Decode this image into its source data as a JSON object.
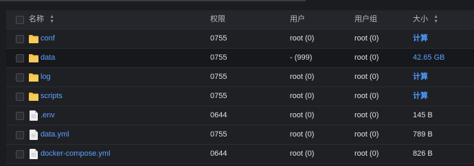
{
  "header": {
    "name_label": "名称",
    "perm_label": "权限",
    "user_label": "用户",
    "group_label": "用户组",
    "size_label": "大小"
  },
  "rows": [
    {
      "name": "conf",
      "type": "folder",
      "perm": "0755",
      "user": "root (0)",
      "group": "root (0)",
      "size": "计算",
      "size_kind": "action"
    },
    {
      "name": "data",
      "type": "folder",
      "perm": "0755",
      "user": "- (999)",
      "group": "root (0)",
      "size": "42.65 GB",
      "size_kind": "link"
    },
    {
      "name": "log",
      "type": "folder",
      "perm": "0755",
      "user": "root (0)",
      "group": "root (0)",
      "size": "计算",
      "size_kind": "action"
    },
    {
      "name": "scripts",
      "type": "folder",
      "perm": "0755",
      "user": "root (0)",
      "group": "root (0)",
      "size": "计算",
      "size_kind": "action"
    },
    {
      "name": ".env",
      "type": "file",
      "perm": "0644",
      "user": "root (0)",
      "group": "root (0)",
      "size": "145 B",
      "size_kind": "text"
    },
    {
      "name": "data.yml",
      "type": "file",
      "perm": "0755",
      "user": "root (0)",
      "group": "root (0)",
      "size": "789 B",
      "size_kind": "text"
    },
    {
      "name": "docker-compose.yml",
      "type": "file",
      "perm": "0644",
      "user": "root (0)",
      "group": "root (0)",
      "size": "826 B",
      "size_kind": "text"
    }
  ],
  "colors": {
    "link": "#5ea2ff",
    "folder": "#f5c04a",
    "background": "#1b1c20"
  }
}
